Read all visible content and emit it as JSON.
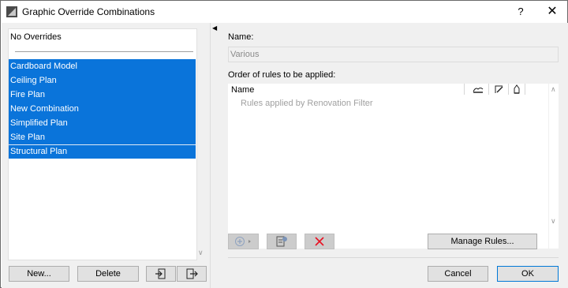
{
  "window": {
    "title": "Graphic Override Combinations",
    "help_label": "?",
    "close_label": "✕"
  },
  "left": {
    "no_overrides": "No Overrides",
    "combinations": [
      "Cardboard Model",
      "Ceiling Plan",
      "Fire Plan",
      "New Combination",
      "Simplified Plan",
      "Site Plan",
      "Structural Plan"
    ],
    "new_label": "New...",
    "delete_label": "Delete"
  },
  "right": {
    "name_label": "Name:",
    "name_value": "Various",
    "order_label": "Order of rules to be applied:",
    "columns": {
      "name": "Name"
    },
    "renovation_text": "Rules applied by Renovation Filter",
    "manage_rules_label": "Manage Rules...",
    "cancel_label": "Cancel",
    "ok_label": "OK"
  },
  "colors": {
    "selection": "#0a74da",
    "delete_icon": "#e81123",
    "ok_border": "#0078d7"
  }
}
